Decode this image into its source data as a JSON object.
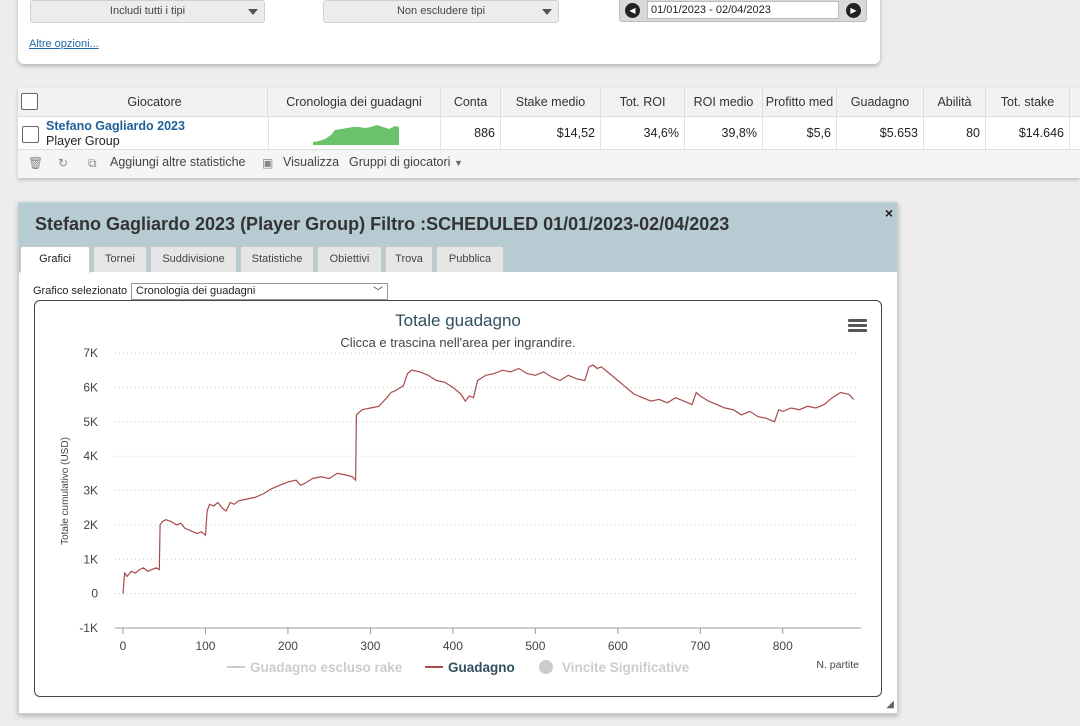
{
  "filters": {
    "type_include": "Includi tutti i tipi",
    "type_exclude": "Non escludere tipi",
    "date_range": "01/01/2023 - 02/04/2023",
    "more_options": "Altre opzioni..."
  },
  "table": {
    "headers": [
      "Giocatore",
      "Cronologia dei guadagni",
      "Conta",
      "Stake medio",
      "Tot. ROI",
      "ROI medio",
      "Profitto med",
      "Guadagno",
      "Abilità",
      "Tot. stake"
    ],
    "row": {
      "player_name": "Stefano Gagliardo 2023",
      "player_type": "Player Group",
      "conta": "886",
      "stake_medio": "$14,52",
      "tot_roi": "34,6%",
      "roi_medio": "39,8%",
      "profitto_medio": "$5,6",
      "guadagno": "$5.653",
      "abilita": "80",
      "tot_stake": "$14.646"
    },
    "toolbar": {
      "add_stats": "Aggiungi altre statistiche",
      "view": "Visualizza",
      "groups": "Gruppi di giocatori"
    }
  },
  "dialog": {
    "title": "Stefano Gagliardo 2023 (Player Group) Filtro :SCHEDULED 01/01/2023-02/04/2023",
    "close": "×",
    "tabs": [
      "Grafici",
      "Tornei",
      "Suddivisione",
      "Statistiche",
      "Obiettivi",
      "Trova",
      "Pubblica"
    ],
    "active_tab": "Grafici",
    "selector_label": "Grafico selezionato",
    "selector_value": "Cronologia dei guadagni"
  },
  "chart_data": {
    "type": "line",
    "title": "Totale guadagno",
    "subtitle": "Clicca e trascina nell'area per ingrandire.",
    "ylabel": "Totale cumulativo (USD)",
    "xlabel": "N. partite",
    "xlim": [
      0,
      890
    ],
    "ylim": [
      -1000,
      7000
    ],
    "x_ticks": [
      "0",
      "100",
      "200",
      "300",
      "400",
      "500",
      "600",
      "700",
      "800"
    ],
    "y_ticks": [
      "-1K",
      "0",
      "1K",
      "2K",
      "3K",
      "4K",
      "5K",
      "6K",
      "7K"
    ],
    "grid": true,
    "legend_position": "bottom",
    "legend": [
      {
        "name": "Guadagno escluso rake",
        "visible": false,
        "color": "#cccccc"
      },
      {
        "name": "Guadagno",
        "visible": true,
        "color": "#a84b4b"
      },
      {
        "name": "Vincite Significative",
        "visible": false,
        "color": "#cccccc"
      }
    ],
    "series": [
      {
        "name": "Guadagno",
        "color": "#a84b4b",
        "x": [
          0,
          2,
          5,
          10,
          15,
          20,
          25,
          30,
          35,
          40,
          44,
          45,
          48,
          52,
          58,
          65,
          70,
          75,
          80,
          85,
          90,
          95,
          100,
          102,
          105,
          110,
          115,
          120,
          125,
          130,
          135,
          140,
          150,
          160,
          170,
          180,
          190,
          200,
          210,
          215,
          220,
          230,
          240,
          250,
          260,
          270,
          278,
          282,
          283,
          290,
          300,
          310,
          320,
          325,
          330,
          340,
          345,
          350,
          360,
          370,
          380,
          390,
          400,
          410,
          415,
          420,
          425,
          430,
          440,
          450,
          460,
          470,
          480,
          490,
          500,
          510,
          520,
          530,
          540,
          550,
          560,
          565,
          570,
          575,
          580,
          590,
          600,
          610,
          620,
          630,
          640,
          650,
          660,
          670,
          680,
          690,
          695,
          700,
          710,
          720,
          730,
          740,
          750,
          760,
          770,
          780,
          790,
          795,
          800,
          810,
          820,
          830,
          840,
          850,
          860,
          870,
          880,
          886
        ],
        "y": [
          0,
          600,
          500,
          650,
          600,
          700,
          750,
          650,
          700,
          750,
          700,
          2000,
          2100,
          2150,
          2100,
          2000,
          2050,
          1900,
          1850,
          1800,
          1750,
          1800,
          1700,
          2400,
          2600,
          2550,
          2650,
          2500,
          2400,
          2650,
          2600,
          2700,
          2750,
          2800,
          2900,
          3050,
          3150,
          3250,
          3300,
          3150,
          3200,
          3350,
          3400,
          3350,
          3500,
          3450,
          3400,
          3300,
          5200,
          5350,
          5400,
          5450,
          5700,
          5850,
          5900,
          6050,
          6400,
          6500,
          6450,
          6350,
          6200,
          6150,
          6000,
          5800,
          5600,
          5750,
          5700,
          6200,
          6350,
          6400,
          6500,
          6450,
          6550,
          6400,
          6350,
          6450,
          6300,
          6200,
          6350,
          6250,
          6200,
          6600,
          6650,
          6550,
          6600,
          6400,
          6200,
          6000,
          5800,
          5700,
          5600,
          5650,
          5550,
          5700,
          5600,
          5500,
          5850,
          5750,
          5600,
          5500,
          5400,
          5350,
          5200,
          5300,
          5150,
          5100,
          5000,
          5350,
          5300,
          5400,
          5350,
          5450,
          5400,
          5500,
          5700,
          5850,
          5800,
          5650
        ]
      }
    ]
  }
}
